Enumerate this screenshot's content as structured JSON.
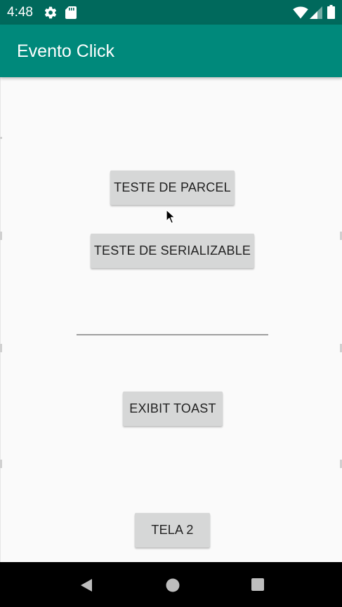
{
  "status_bar": {
    "time": "4:48",
    "icons": [
      "gear-icon",
      "sd-card-icon",
      "wifi-icon",
      "cell-signal-icon",
      "battery-icon"
    ],
    "background_color": "#00695c"
  },
  "app_bar": {
    "title": "Evento Click",
    "background_color": "#00897b"
  },
  "main": {
    "buttons": {
      "parcel": "TESTE DE PARCEL",
      "serializable": "TESTE DE SERIALIZABLE",
      "toast": "EXIBIT TOAST",
      "tela2": "TELA 2"
    },
    "text_field": {
      "value": "",
      "placeholder": ""
    }
  },
  "nav_bar": {
    "icons": [
      "back-icon",
      "home-icon",
      "recents-icon"
    ]
  }
}
